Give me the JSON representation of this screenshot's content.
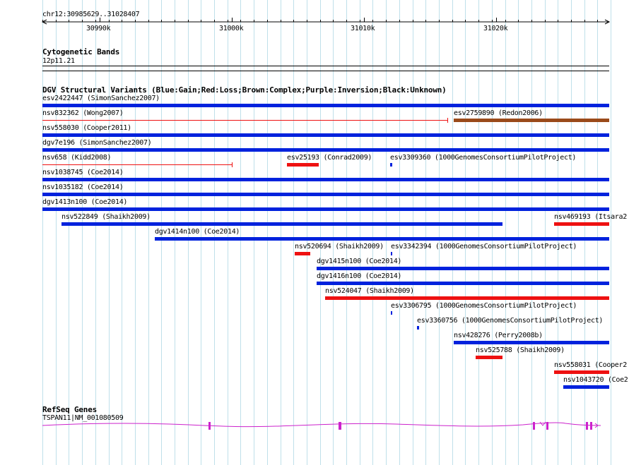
{
  "ruler": {
    "title": "chr12:30985629..31028407",
    "ticks": [
      {
        "label": "30990k"
      },
      {
        "label": "31000k"
      },
      {
        "label": "31010k"
      },
      {
        "label": "31020k"
      }
    ]
  },
  "cytoband": {
    "title": "Cytogenetic Bands",
    "band": "12p11.21"
  },
  "dgv": {
    "title": "DGV Structural Variants (Blue:Gain;Red:Loss;Brown:Complex;Purple:Inversion;Black:Unknown)",
    "colors": {
      "gain": "#0022dd",
      "loss": "#ee1111",
      "complex": "#9a4a1a"
    },
    "features": [
      {
        "id": "esv2422447",
        "label": "esv2422447 (SimonSanchez2007)"
      },
      {
        "id": "nsv832362",
        "label": "nsv832362 (Wong2007)"
      },
      {
        "id": "esv2759890",
        "label": "esv2759890 (Redon2006)"
      },
      {
        "id": "nsv558030",
        "label": "nsv558030 (Cooper2011)"
      },
      {
        "id": "dgv7e196",
        "label": "dgv7e196 (SimonSanchez2007)"
      },
      {
        "id": "nsv658",
        "label": "nsv658 (Kidd2008)"
      },
      {
        "id": "esv25193",
        "label": "esv25193 (Conrad2009)"
      },
      {
        "id": "esv3309360",
        "label": "esv3309360 (1000GenomesConsortiumPilotProject)"
      },
      {
        "id": "nsv1038745",
        "label": "nsv1038745 (Coe2014)"
      },
      {
        "id": "nsv1035182",
        "label": "nsv1035182 (Coe2014)"
      },
      {
        "id": "dgv1413n100",
        "label": "dgv1413n100 (Coe2014)"
      },
      {
        "id": "nsv522849",
        "label": "nsv522849 (Shaikh2009)"
      },
      {
        "id": "nsv469193",
        "label": "nsv469193 (Itsara2"
      },
      {
        "id": "dgv1414n100",
        "label": "dgv1414n100 (Coe2014)"
      },
      {
        "id": "nsv520694",
        "label": "nsv520694 (Shaikh2009)"
      },
      {
        "id": "esv3342394",
        "label": "esv3342394 (1000GenomesConsortiumPilotProject)"
      },
      {
        "id": "dgv1415n100",
        "label": "dgv1415n100 (Coe2014)"
      },
      {
        "id": "dgv1416n100",
        "label": "dgv1416n100 (Coe2014)"
      },
      {
        "id": "nsv524047",
        "label": "nsv524047 (Shaikh2009)"
      },
      {
        "id": "esv3306795",
        "label": "esv3306795 (1000GenomesConsortiumPilotProject)"
      },
      {
        "id": "esv3360756",
        "label": "esv3360756 (1000GenomesConsortiumPilotProject)"
      },
      {
        "id": "nsv428276",
        "label": "nsv428276 (Perry2008b)"
      },
      {
        "id": "nsv525788",
        "label": "nsv525788 (Shaikh2009)"
      },
      {
        "id": "nsv558031",
        "label": "nsv558031 (Cooper2"
      },
      {
        "id": "nsv1043720",
        "label": "nsv1043720 (Coe2"
      }
    ]
  },
  "refseq": {
    "title": "RefSeq Genes",
    "gene_label": "TSPAN11|NM_001080509",
    "color": "#cc22cc"
  }
}
